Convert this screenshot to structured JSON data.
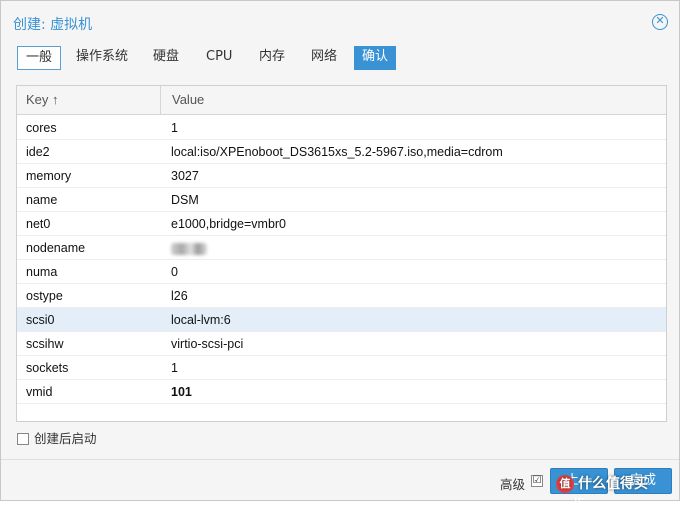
{
  "window": {
    "title": "创建: 虚拟机",
    "close_icon": "close-circle-icon"
  },
  "tabs": [
    {
      "label": "一般",
      "state": "outlined"
    },
    {
      "label": "操作系统",
      "state": "normal"
    },
    {
      "label": "硬盘",
      "state": "normal"
    },
    {
      "label": "CPU",
      "state": "normal"
    },
    {
      "label": "内存",
      "state": "normal"
    },
    {
      "label": "网络",
      "state": "normal"
    },
    {
      "label": "确认",
      "state": "active"
    }
  ],
  "grid": {
    "columns": {
      "key": "Key ↑",
      "value": "Value"
    },
    "rows": [
      {
        "key": "cores",
        "value": "1"
      },
      {
        "key": "ide2",
        "value": "local:iso/XPEnoboot_DS3615xs_5.2-5967.iso,media=cdrom"
      },
      {
        "key": "memory",
        "value": "3027"
      },
      {
        "key": "name",
        "value": "DSM"
      },
      {
        "key": "net0",
        "value": "e1000,bridge=vmbr0"
      },
      {
        "key": "nodename",
        "value": ""
      },
      {
        "key": "numa",
        "value": "0"
      },
      {
        "key": "ostype",
        "value": "l26"
      },
      {
        "key": "scsi0",
        "value": "local-lvm:6"
      },
      {
        "key": "scsihw",
        "value": "virtio-scsi-pci"
      },
      {
        "key": "sockets",
        "value": "1"
      },
      {
        "key": "vmid",
        "value": "101"
      }
    ]
  },
  "autostart": {
    "label": "创建后启动",
    "checked": false
  },
  "footer": {
    "advanced_label": "高级",
    "advanced_checked": true,
    "advanced_check_glyph": "☑",
    "back_label": "上一步",
    "finish_label": "完成"
  },
  "watermark": {
    "text": "什么值得买",
    "logo_glyph": "值"
  },
  "colors": {
    "accent": "#3892d4",
    "selected_row": "#e3eef9",
    "background": "#f5f5f5"
  }
}
